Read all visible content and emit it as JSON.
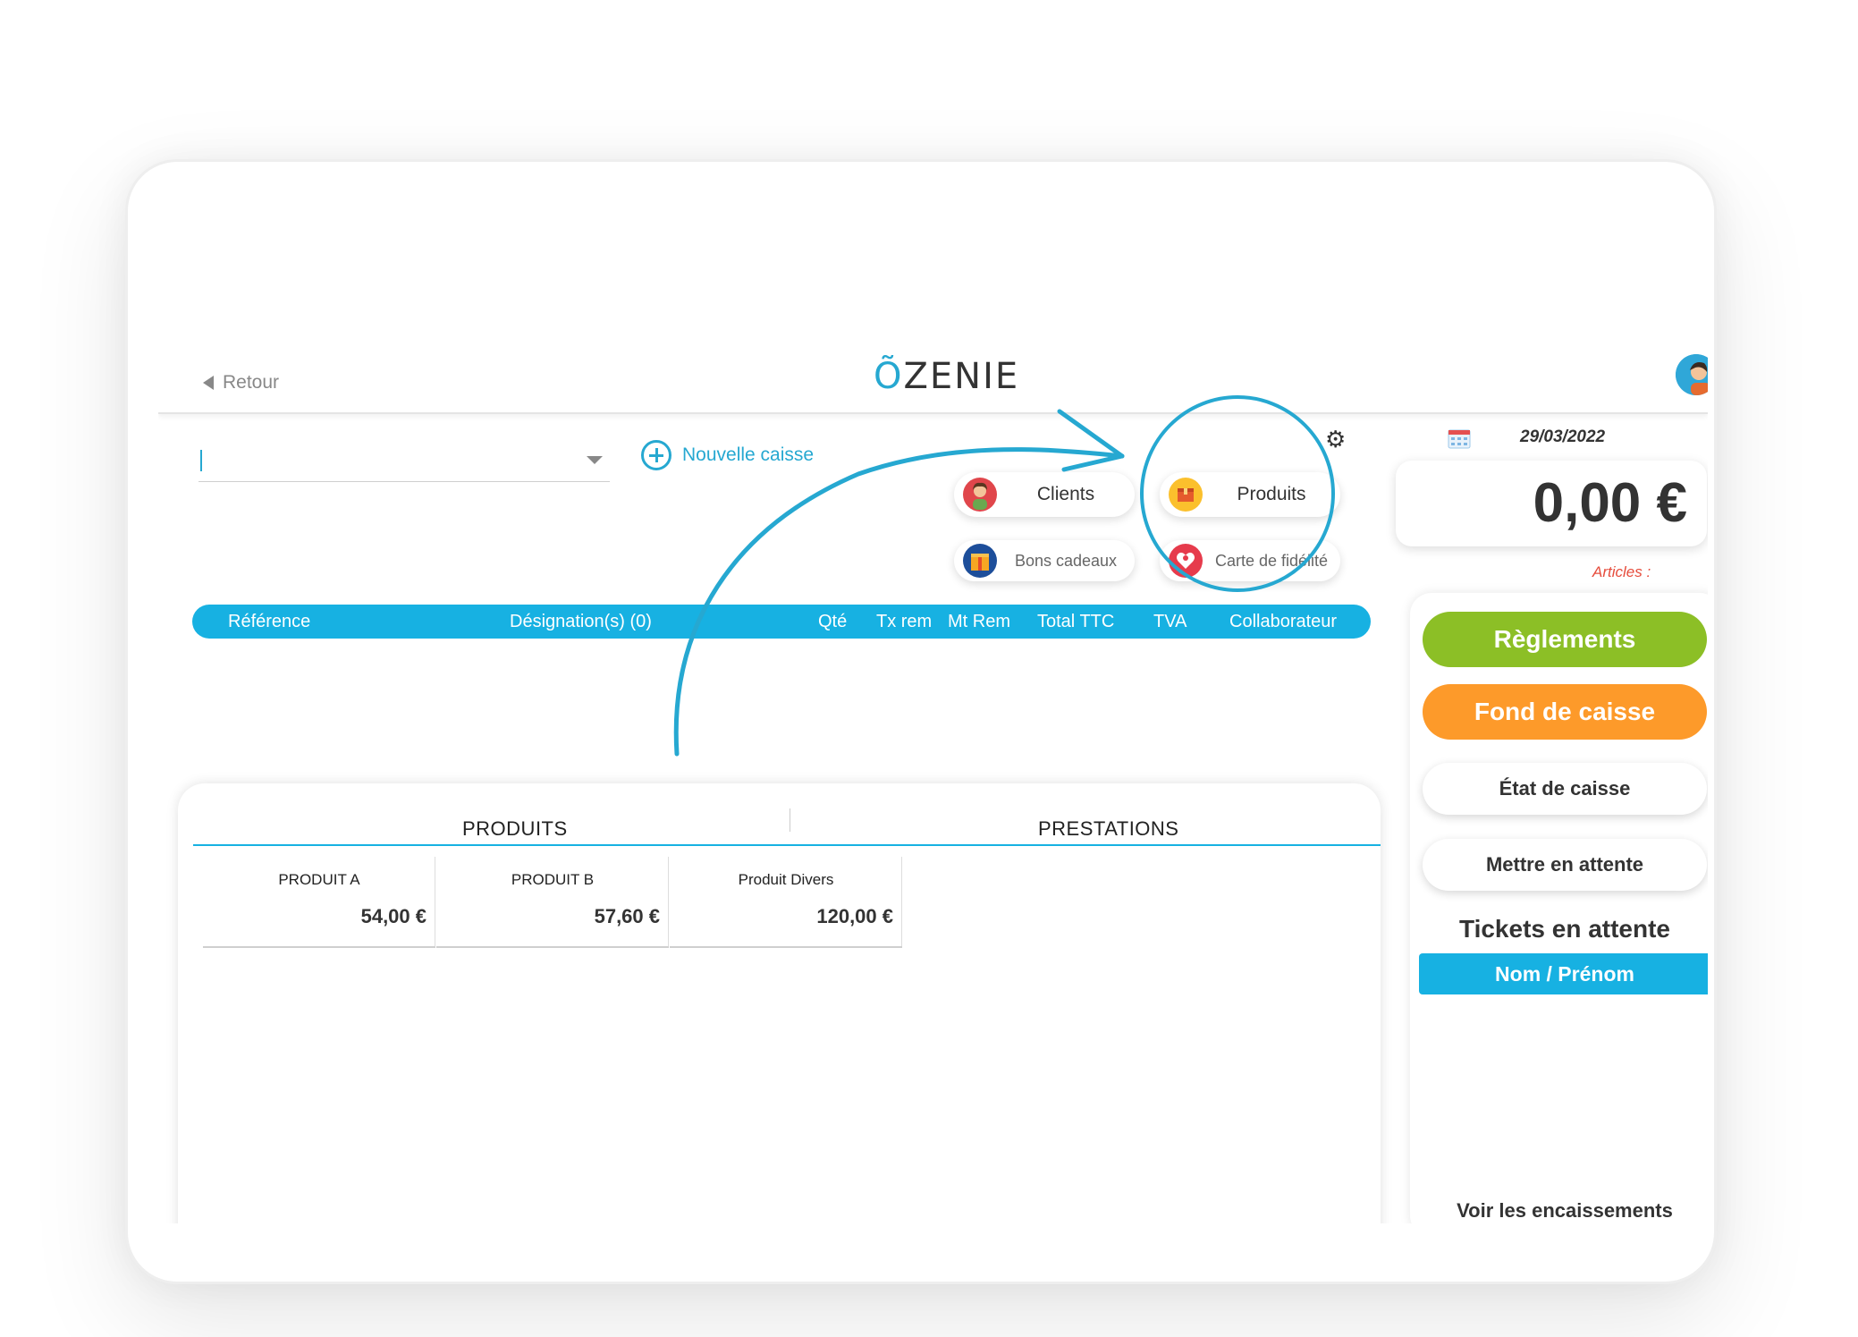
{
  "header": {
    "back_label": "Retour",
    "logo_text": "ZENIE",
    "logo_mark": "Õ"
  },
  "register": {
    "selected_value": "|",
    "new_label": "Nouvelle caisse"
  },
  "shortcuts": {
    "clients": "Clients",
    "produits": "Produits",
    "bons_cadeaux": "Bons cadeaux",
    "carte_fidelite": "Carte de fidélité"
  },
  "table": {
    "columns": [
      "Référence",
      "Désignation(s) (0)",
      "Qté",
      "Tx rem",
      "Mt Rem",
      "Total TTC",
      "TVA",
      "Collaborateur"
    ]
  },
  "catalog": {
    "tabs": [
      "PRODUITS",
      "PRESTATIONS"
    ],
    "items": [
      {
        "name": "PRODUIT A",
        "price": "54,00 €"
      },
      {
        "name": "PRODUIT B",
        "price": "57,60 €"
      },
      {
        "name": "Produit Divers",
        "price": "120,00 €"
      }
    ]
  },
  "sidebar": {
    "date": "29/03/2022",
    "total": "0,00 €",
    "articles_label": "Articles :",
    "buttons": {
      "reglements": "Règlements",
      "fond_caisse": "Fond de caisse",
      "etat_caisse": "État de caisse",
      "mettre_attente": "Mettre en attente"
    },
    "tickets_title": "Tickets en attente",
    "tickets_column": "Nom / Prénom",
    "voir_encaissements": "Voir les encaissements"
  },
  "colors": {
    "primary": "#17b1e2",
    "green": "#8cbf26",
    "orange": "#fd9a2a",
    "alert": "#e64c3c"
  }
}
